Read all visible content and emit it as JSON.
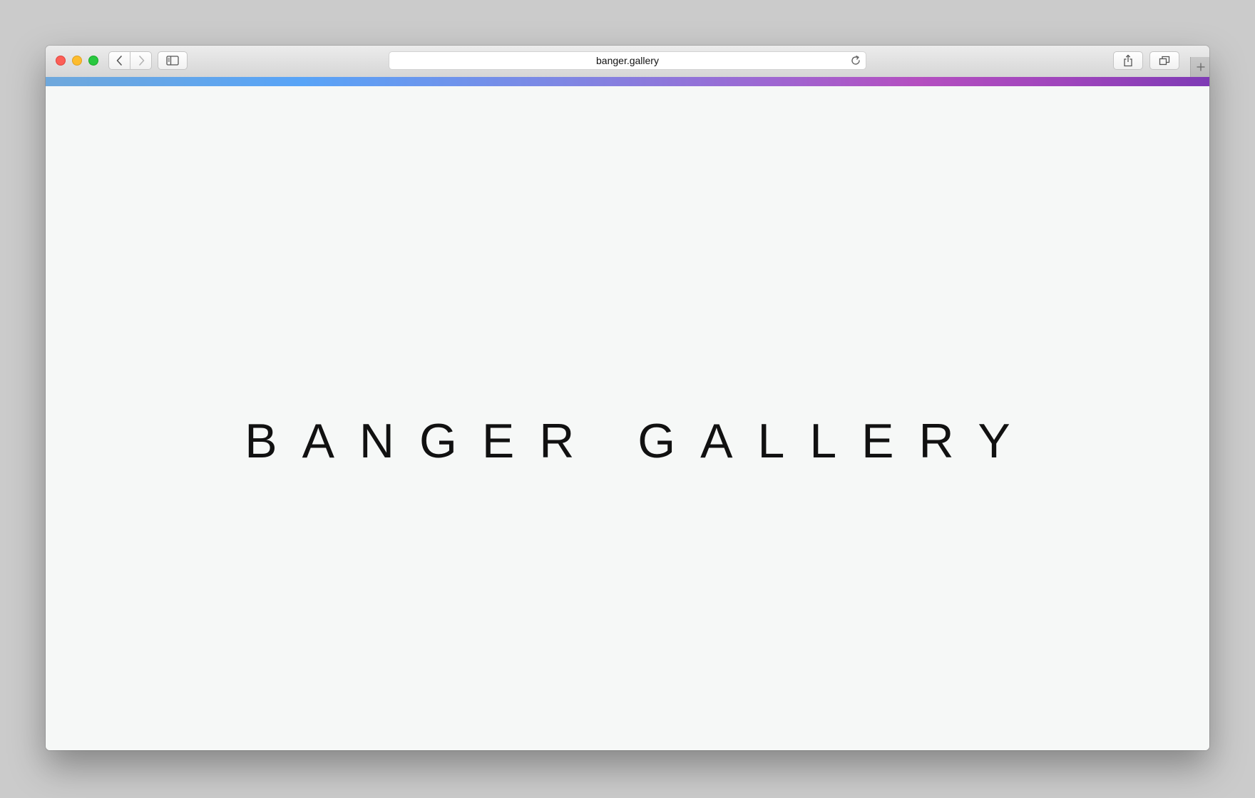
{
  "browser": {
    "url": "banger.gallery",
    "progress_gradient": [
      "#6fa8dc",
      "#58a4f7",
      "#9d67d2",
      "#b44fc0",
      "#7e3bb5"
    ],
    "icons": {
      "close": "close-traffic-light",
      "minimize": "minimize-traffic-light",
      "maximize": "maximize-traffic-light",
      "back": "chevron-left-icon",
      "forward": "chevron-right-icon",
      "sidebar": "sidebar-icon",
      "reload": "reload-icon",
      "share": "share-icon",
      "tabs": "tabs-overview-icon",
      "new_tab": "plus-icon"
    }
  },
  "page": {
    "title": "BANGER GALLERY",
    "background": "#f6f8f7",
    "text_color": "#111111"
  }
}
